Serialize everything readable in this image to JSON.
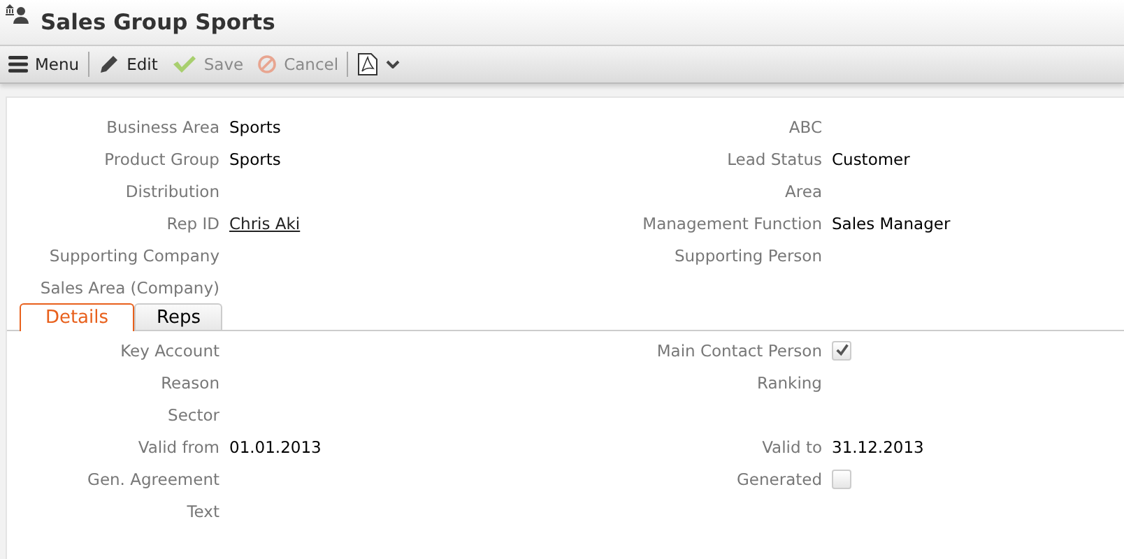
{
  "window": {
    "title": "Sales Group Sports"
  },
  "toolbar": [
    {
      "label": "Menu",
      "kind": "menu",
      "disabled": false
    },
    {
      "label": "Edit",
      "kind": "edit",
      "disabled": false
    },
    {
      "label": "Save",
      "kind": "save",
      "disabled": true
    },
    {
      "label": "Cancel",
      "kind": "cancel",
      "disabled": true
    },
    {
      "kind": "pdf"
    }
  ],
  "header_fields": [
    {
      "left": {
        "label": "Business Area",
        "value": "Sports"
      },
      "right": {
        "label": "ABC"
      }
    },
    {
      "left": {
        "label": "Product Group",
        "value": "Sports"
      },
      "right": {
        "label": "Lead Status",
        "value": "Customer"
      }
    },
    {
      "left": {
        "label": "Distribution"
      },
      "right": {
        "label": "Area"
      }
    },
    {
      "left": {
        "label": "Rep ID",
        "value": "Chris Aki",
        "kind": "link"
      },
      "right": {
        "label": "Management Function",
        "value": "Sales Manager"
      }
    },
    {
      "left": {
        "label": "Supporting Company"
      },
      "right": {
        "label": "Supporting Person"
      }
    },
    {
      "left": {
        "label": "Sales Area (Company)"
      }
    }
  ],
  "tabs": [
    {
      "label": "Details",
      "selected": true
    },
    {
      "label": "Reps",
      "selected": false
    }
  ],
  "details_fields": [
    {
      "left": {
        "label": "Key Account"
      },
      "right": {
        "label": "Main Contact Person",
        "kind": "checkbox",
        "checked": true
      }
    },
    {
      "left": {
        "label": "Reason"
      },
      "right": {
        "label": "Ranking"
      }
    },
    {
      "left": {
        "label": "Sector"
      }
    },
    {
      "left": {
        "label": "Valid from",
        "value": "01.01.2013"
      },
      "right": {
        "label": "Valid to",
        "value": "31.12.2013"
      }
    },
    {
      "left": {
        "label": "Gen. Agreement"
      },
      "right": {
        "label": "Generated",
        "kind": "checkbox",
        "checked": false
      }
    },
    {
      "left": {
        "label": "Text"
      }
    }
  ]
}
